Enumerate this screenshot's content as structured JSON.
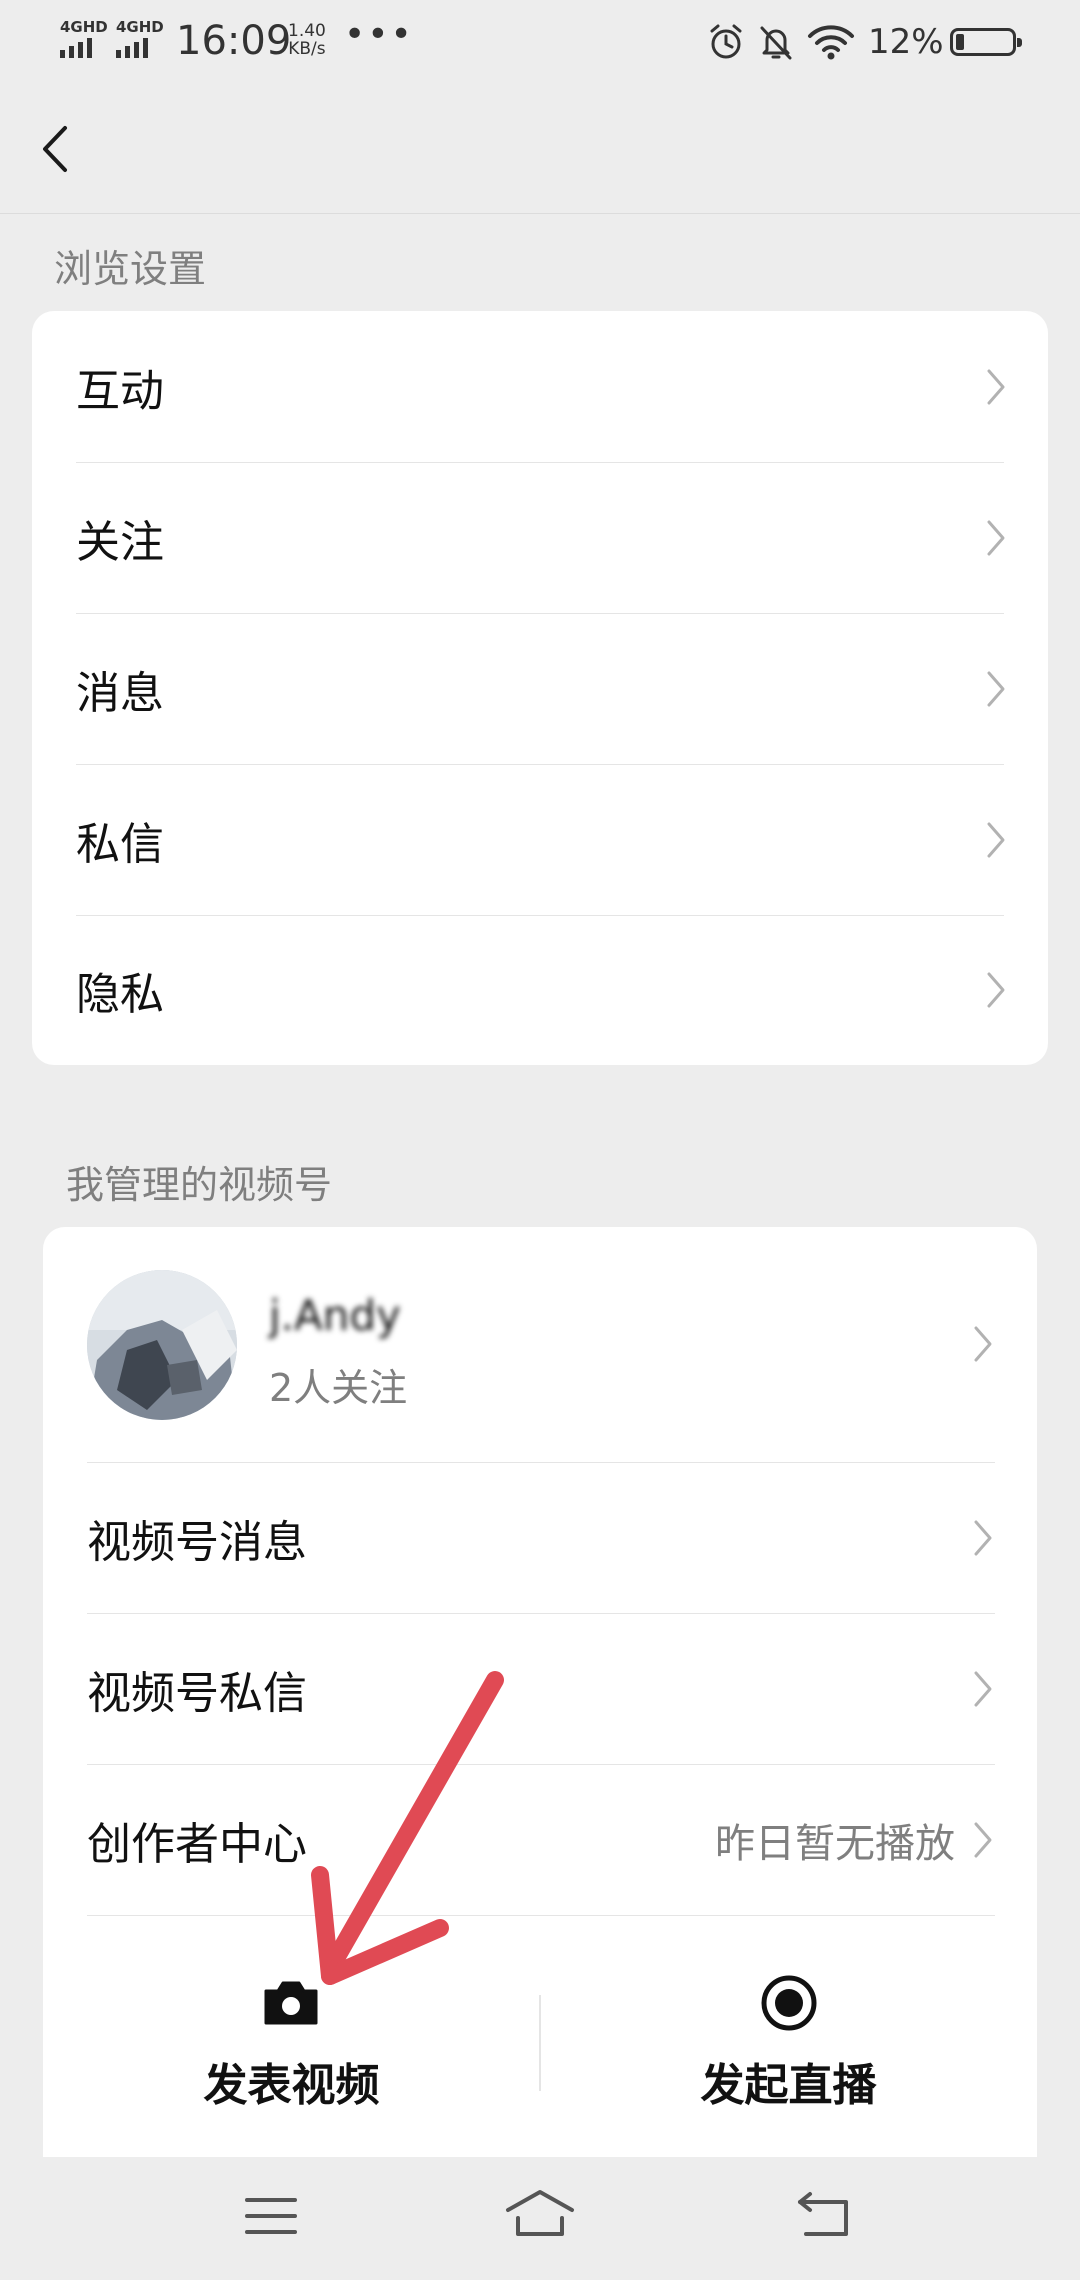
{
  "status_bar": {
    "network_1": "4GHD",
    "network_2": "4GHD",
    "time": "16:09",
    "speed_value": "1.40",
    "speed_unit": "KB/s",
    "more": "•••",
    "battery": "12%",
    "icons": [
      "alarm-icon",
      "mute-icon",
      "wifi-icon",
      "battery-icon"
    ]
  },
  "header": {
    "back_icon": "chevron-left-icon"
  },
  "browse_settings": {
    "title": "浏览设置",
    "items": [
      {
        "label": "互动"
      },
      {
        "label": "关注"
      },
      {
        "label": "消息"
      },
      {
        "label": "私信"
      },
      {
        "label": "隐私"
      }
    ]
  },
  "channels": {
    "title": "我管理的视频号",
    "account": {
      "name": "j.Andy",
      "followers": "2人关注"
    },
    "items": [
      {
        "label": "视频号消息",
        "value": ""
      },
      {
        "label": "视频号私信",
        "value": ""
      },
      {
        "label": "创作者中心",
        "value": "昨日暂无播放"
      }
    ],
    "actions": {
      "post_video": "发表视频",
      "go_live": "发起直播"
    }
  },
  "bottom_nav": {
    "icons": [
      "menu-icon",
      "home-icon",
      "back-icon"
    ]
  },
  "colors": {
    "background": "#ededed",
    "card": "#ffffff",
    "arrow_annotation": "#e04a54",
    "secondary_text": "#7f7f7f"
  }
}
